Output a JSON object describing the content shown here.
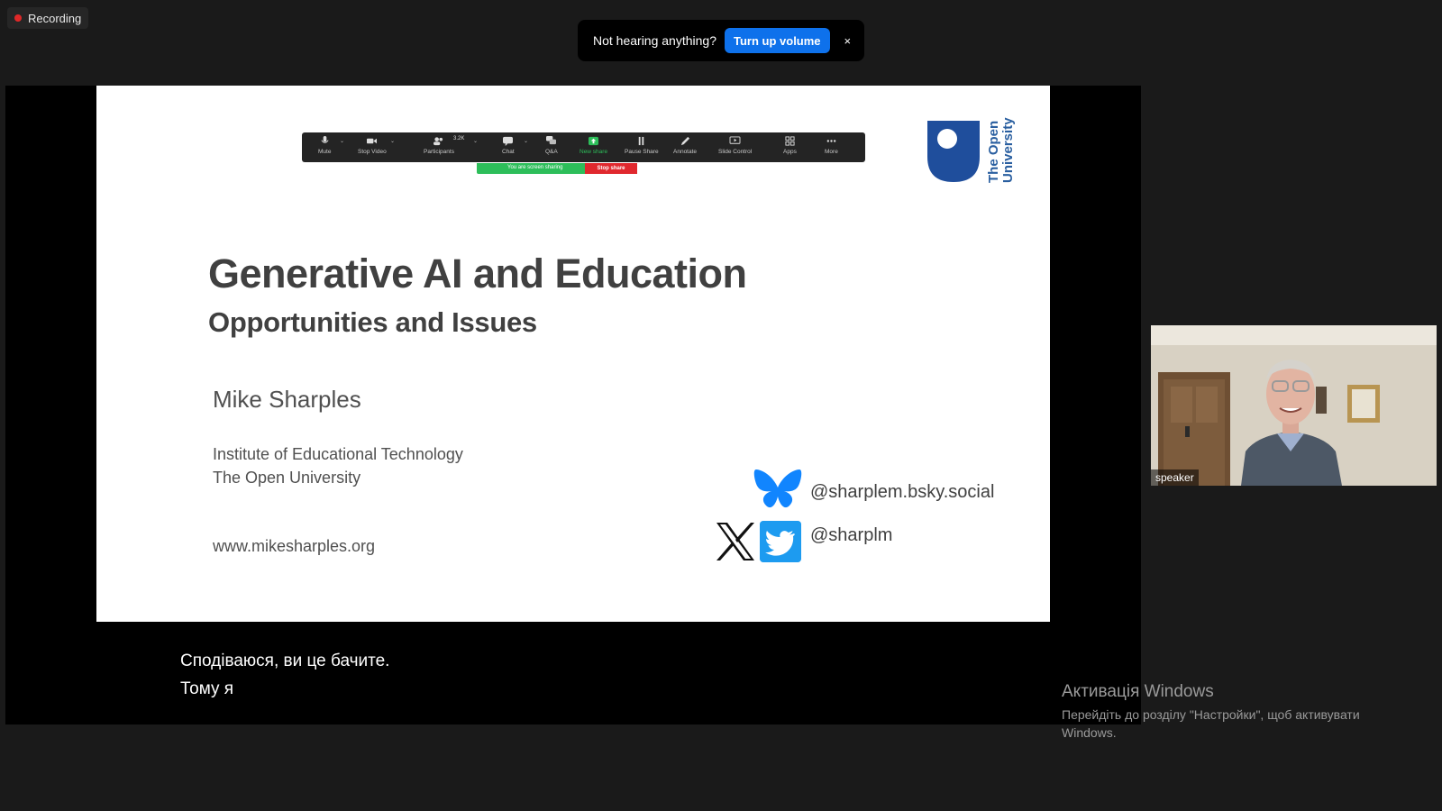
{
  "recording": {
    "label": "Recording",
    "dot_color": "#e02828"
  },
  "audio_toast": {
    "message": "Not hearing anything?",
    "action_label": "Turn up volume",
    "close_glyph": "×",
    "action_color": "#0e71eb"
  },
  "slide": {
    "toolbar": {
      "items": [
        {
          "label": "Mute",
          "icon": "microphone-icon"
        },
        {
          "label": "Stop Video",
          "icon": "video-camera-icon"
        },
        {
          "label": "Participants",
          "icon": "participants-icon",
          "count": "3.2K"
        },
        {
          "label": "Chat",
          "icon": "chat-icon"
        },
        {
          "label": "Q&A",
          "icon": "qa-icon"
        },
        {
          "label": "New share",
          "icon": "new-share-icon"
        },
        {
          "label": "Pause Share",
          "icon": "pause-icon"
        },
        {
          "label": "Annotate",
          "icon": "pencil-icon"
        },
        {
          "label": "Slide Control",
          "icon": "slide-control-icon"
        },
        {
          "label": "Apps",
          "icon": "apps-icon"
        },
        {
          "label": "More",
          "icon": "more-dots-icon"
        }
      ],
      "sharing_text": "You are screen sharing",
      "stop_share_label": "Stop share"
    },
    "logo_text": "The Open University",
    "title": "Generative AI and Education",
    "subtitle": "Opportunities and Issues",
    "author": "Mike Sharples",
    "institute_line1": "Institute of Educational Technology",
    "institute_line2": "The Open University",
    "website": "www.mikesharples.org",
    "bluesky_handle": "@sharplem.bsky.social",
    "twitter_handle": "@sharplm",
    "colors": {
      "ou_blue": "#1f4e9c",
      "bluesky": "#1185fe",
      "twitter": "#1d9bf0"
    }
  },
  "captions": {
    "line1": "Сподіваюся, ви це бачите.",
    "line2": "Тому я"
  },
  "video": {
    "name_label": "speaker"
  },
  "windows_activation": {
    "title": "Активація Windows",
    "line1": "Перейдіть до розділу \"Настройки\", щоб активувати",
    "line2": "Windows."
  }
}
